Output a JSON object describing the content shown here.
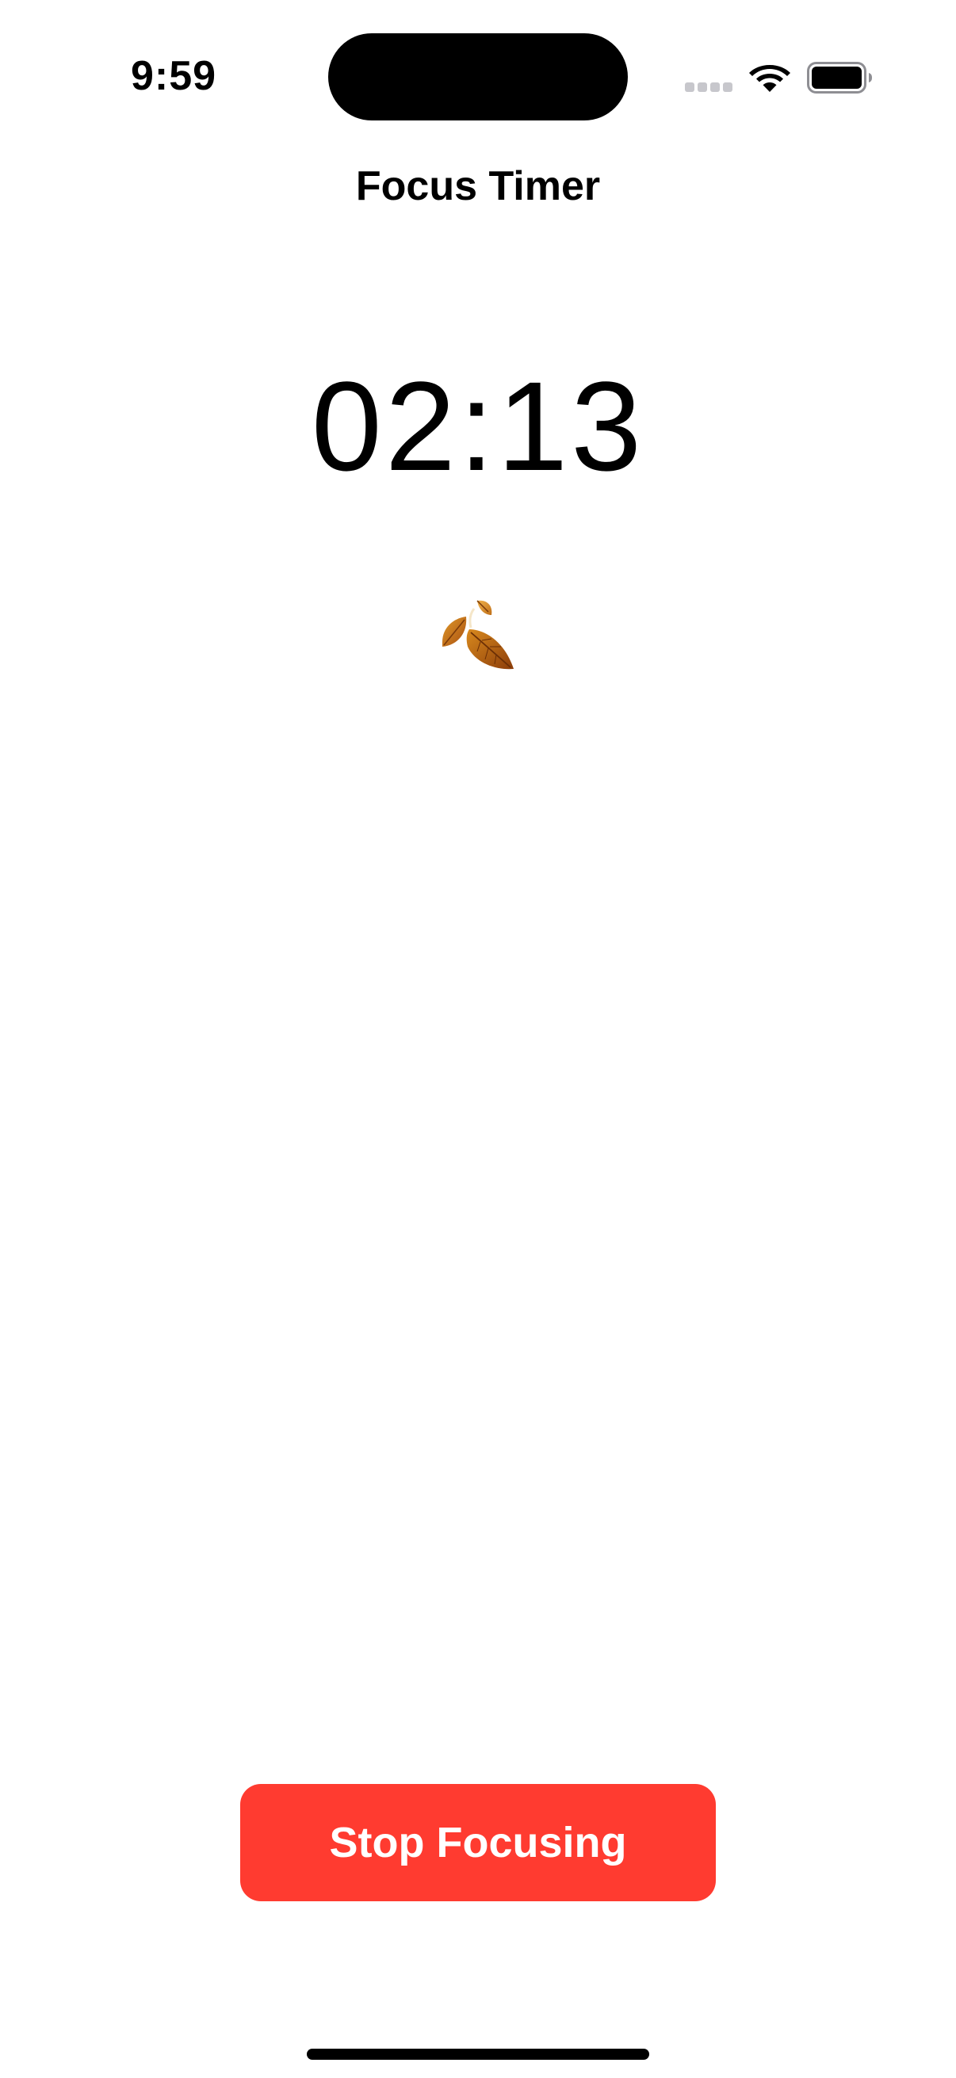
{
  "status_bar": {
    "time": "9:59",
    "icons": [
      "signal-icon",
      "wifi-icon",
      "battery-icon"
    ]
  },
  "nav": {
    "title": "Focus Timer"
  },
  "timer": {
    "value": "02:13"
  },
  "illustration": {
    "icon": "fallen-leaves-icon"
  },
  "actions": {
    "stop_label": "Stop Focusing"
  },
  "colors": {
    "stop_button": "#ff3b30",
    "background": "#ffffff",
    "text": "#000000"
  }
}
